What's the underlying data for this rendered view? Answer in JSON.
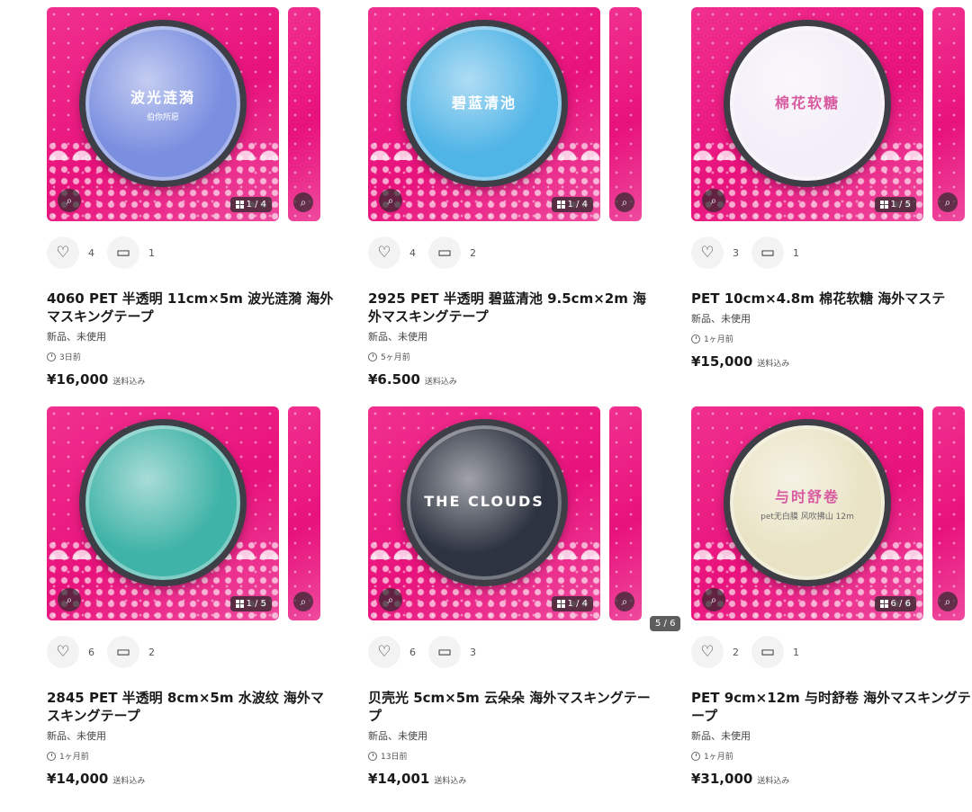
{
  "products": [
    {
      "image_label": "波光涟漪",
      "image_sublabel": "伯你所愿",
      "image_counter": "1 / 4",
      "tape_color": "#7b8fe0",
      "likes": "4",
      "comments": "1",
      "title": "4060 PET 半透明 11cm×5m 波光涟漪 海外マスキングテープ",
      "condition": "新品、未使用",
      "posted": "3日前",
      "price": "¥16,000",
      "shipping": "送料込み"
    },
    {
      "image_label": "碧蓝清池",
      "image_sublabel": "",
      "image_counter": "1 / 4",
      "tape_color": "#4fb4e6",
      "likes": "4",
      "comments": "2",
      "title": "2925 PET 半透明 碧蓝清池 9.5cm×2m 海外マスキングテープ",
      "condition": "新品、未使用",
      "posted": "5ヶ月前",
      "price": "¥6.500",
      "shipping": "送料込み"
    },
    {
      "image_label": "棉花软糖",
      "image_sublabel": "",
      "image_counter": "1 / 5",
      "tape_color": "#f3eef8",
      "likes": "3",
      "comments": "1",
      "title": "PET 10cm×4.8m 棉花软糖 海外マステ",
      "condition": "新品、未使用",
      "posted": "1ヶ月前",
      "price": "¥15,000",
      "shipping": "送料込み"
    },
    {
      "image_label": "",
      "image_sublabel": "",
      "image_counter": "1 / 5",
      "tape_color": "#3fb3a7",
      "likes": "6",
      "comments": "2",
      "title": "2845 PET 半透明 8cm×5m 水波纹 海外マスキングテープ",
      "condition": "新品、未使用",
      "posted": "1ヶ月前",
      "price": "¥14,000",
      "shipping": "送料込み"
    },
    {
      "image_label": "THE CLOUDS",
      "image_sublabel": "",
      "image_counter": "1 / 4",
      "tape_color": "#2d3340",
      "likes": "6",
      "comments": "3",
      "title": "贝壳光 5cm×5m 云朵朵 海外マスキングテープ",
      "condition": "新品、未使用",
      "posted": "13日前",
      "price": "¥14,001",
      "shipping": "送料込み"
    },
    {
      "image_label": "与时舒卷",
      "image_sublabel": "pet无白膜 风吹拂山 12m",
      "image_counter": "6 / 6",
      "tape_color": "#e9e3c4",
      "likes": "2",
      "comments": "1",
      "title": "PET 9cm×12m 与时舒卷 海外マスキングテープ",
      "condition": "新品、未使用",
      "posted": "1ヶ月前",
      "price": "¥31,000",
      "shipping": "送料込み"
    }
  ],
  "side_counter": "5 / 6",
  "icons": {
    "like": "heart-icon",
    "comment": "comment-icon",
    "lens": "lens-search-icon",
    "gallery": "grid-icon",
    "clock": "clock-icon"
  }
}
